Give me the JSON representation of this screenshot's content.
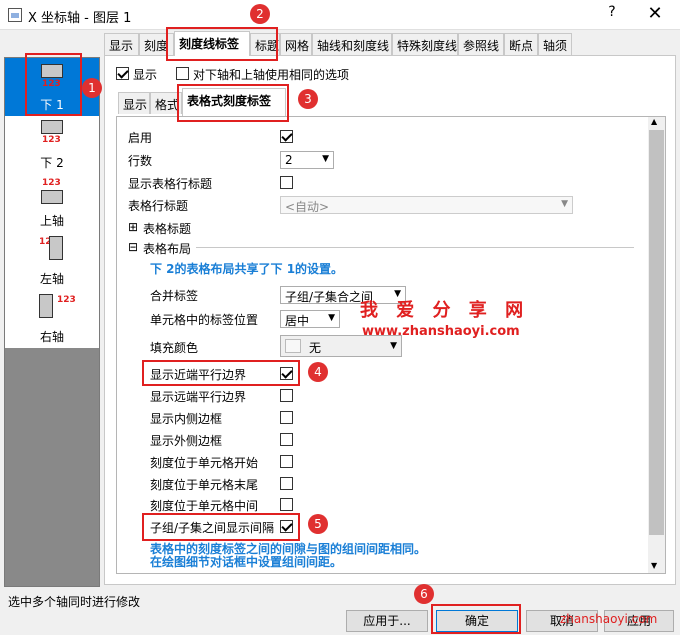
{
  "window": {
    "title": "X 坐标轴 - 图层 1",
    "help": "?",
    "close": "✕"
  },
  "axes": [
    {
      "label": "下 1",
      "nums": "123"
    },
    {
      "label": "下 2",
      "nums": "123"
    },
    {
      "label": "上轴",
      "nums": "123"
    },
    {
      "label": "左轴",
      "nums": "123"
    },
    {
      "label": "右轴",
      "nums": "123"
    }
  ],
  "top_tabs": [
    "显示",
    "刻度",
    "刻度线标签",
    "标题",
    "网格",
    "轴线和刻度线",
    "特殊刻度线",
    "参照线",
    "断点",
    "轴须"
  ],
  "show_label": "显示",
  "same_label": "对下轴和上轴使用相同的选项",
  "sub_tabs": [
    "显示",
    "格式",
    "表格式刻度标签"
  ],
  "rows": {
    "enable": "启用",
    "row_count": "行数",
    "row_count_value": "2",
    "show_row_title": "显示表格行标题",
    "row_title": "表格行标题",
    "row_title_value": "<自动>",
    "table_title": "表格标题",
    "table_layout": "表格布局",
    "layout_note": "下 2的表格布局共享了下 1的设置。",
    "merge_label": "合并标签",
    "merge_value": "子组/子集合之间",
    "cell_pos": "单元格中的标签位置",
    "cell_pos_value": "居中",
    "fill_color": "填充颜色",
    "fill_value": "无",
    "near_border": "显示近端平行边界",
    "far_border": "显示远端平行边界",
    "inner_border": "显示内侧边框",
    "outer_border": "显示外侧边框",
    "tick_start": "刻度位于单元格开始",
    "tick_end": "刻度位于单元格末尾",
    "tick_mid": "刻度位于单元格中间",
    "subgroup_gap": "子组/子集之间显示间隔",
    "gap_note1": "表格中的刻度标签之间的间隙与图的组间间距相同。",
    "gap_note2": "在绘图细节对话框中设置组间间距。"
  },
  "status_text": "选中多个轴同时进行修改",
  "buttons": {
    "apply_to": "应用于...",
    "ok": "确定",
    "cancel": "取消",
    "apply": "应用"
  },
  "watermark": {
    "big": "我 爱 分 享 网",
    "url": "www.zhanshaoyi.com",
    "corner": "zhanshaoyi.com"
  },
  "badges": [
    "1",
    "2",
    "3",
    "4",
    "5",
    "6"
  ],
  "colors": {
    "accent": "#0078d7",
    "annotation_red": "#e02020",
    "note_blue": "#1a7fd6"
  }
}
